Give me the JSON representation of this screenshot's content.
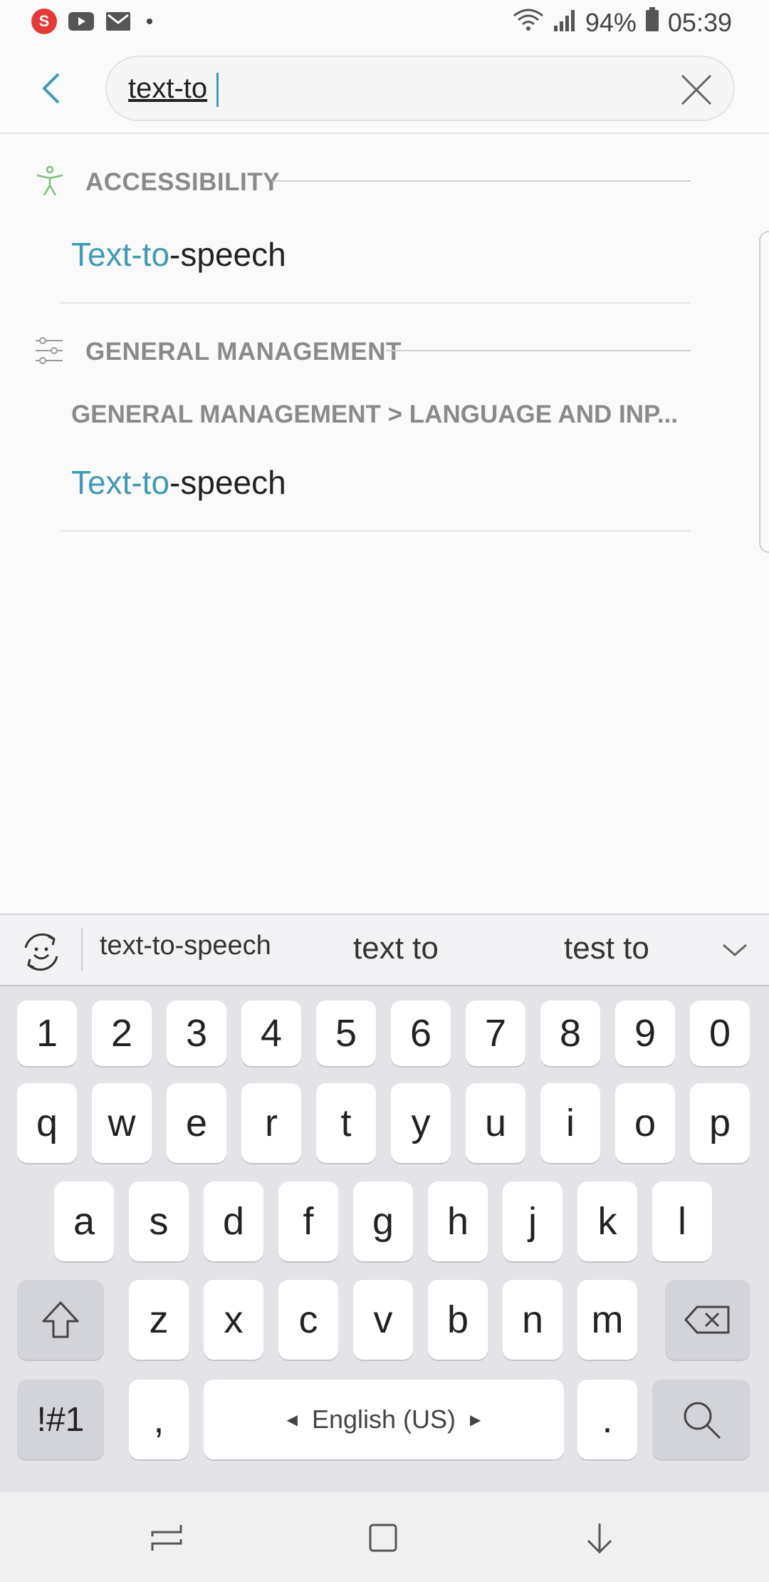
{
  "status_bar": {
    "app_badge": "S",
    "battery": "94%",
    "time": "05:39"
  },
  "search": {
    "query": "text-to",
    "placeholder": ""
  },
  "results": {
    "sections": [
      {
        "title": "ACCESSIBILITY",
        "items": [
          {
            "path": "",
            "highlight": "Text-to",
            "rest": "-speech"
          }
        ]
      },
      {
        "title": "GENERAL MANAGEMENT",
        "items": [
          {
            "path": "GENERAL MANAGEMENT > LANGUAGE AND INP...",
            "highlight": "Text-to",
            "rest": "-speech"
          }
        ]
      }
    ]
  },
  "keyboard": {
    "suggestions": [
      "text-to-speech",
      "text to",
      "test to"
    ],
    "row_numbers": [
      "1",
      "2",
      "3",
      "4",
      "5",
      "6",
      "7",
      "8",
      "9",
      "0"
    ],
    "row_1": [
      "q",
      "w",
      "e",
      "r",
      "t",
      "y",
      "u",
      "i",
      "o",
      "p"
    ],
    "row_2": [
      "a",
      "s",
      "d",
      "f",
      "g",
      "h",
      "j",
      "k",
      "l"
    ],
    "row_3": [
      "z",
      "x",
      "c",
      "v",
      "b",
      "n",
      "m"
    ],
    "symbols_key": "!#1",
    "comma_key": ",",
    "space_label": "English (US)",
    "period_key": ".",
    "icons": {
      "shift": "shift-icon",
      "backspace": "backspace-icon",
      "search": "search-icon"
    }
  },
  "colors": {
    "accent": "#3e9bb5",
    "section_title": "#8a8a8a",
    "keyboard_bg": "#e3e3e8",
    "badge": "#e53935"
  }
}
